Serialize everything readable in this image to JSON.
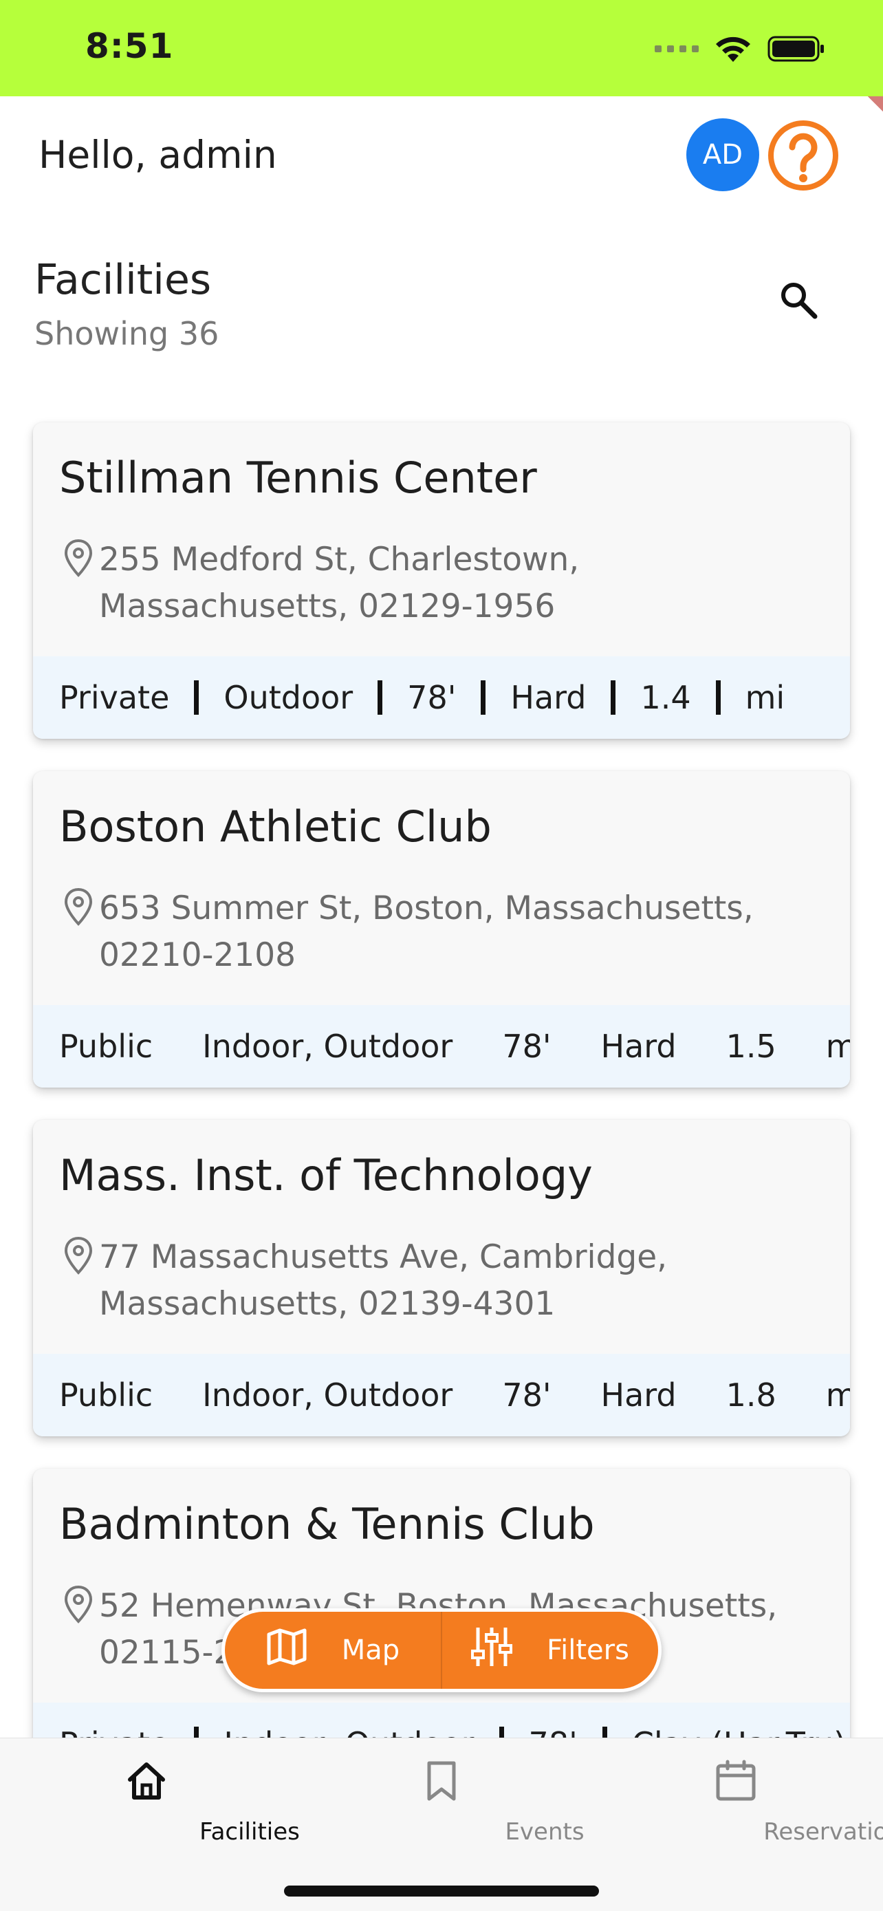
{
  "status_bar": {
    "time": "8:51"
  },
  "header": {
    "greeting": "Hello, admin",
    "avatar_initials": "AD"
  },
  "section": {
    "title": "Facilities",
    "count_text": "Showing 36"
  },
  "facilities": [
    {
      "name": "Stillman Tennis Center",
      "address": "255 Medford St, Charlestown, Massachusetts, 02129-1956",
      "tags": [
        "Private",
        "Outdoor",
        "78'",
        "Hard",
        "1.4",
        "mi"
      ]
    },
    {
      "name": "Boston Athletic Club",
      "address": "653 Summer St, Boston, Massachusetts, 02210-2108",
      "tags": [
        "Public",
        "Indoor, Outdoor",
        "78'",
        "Hard",
        "1.5",
        "mi"
      ]
    },
    {
      "name": "Mass. Inst. of Technology",
      "address": "77 Massachusetts Ave, Cambridge, Massachusetts, 02139-4301",
      "tags": [
        "Public",
        "Indoor, Outdoor",
        "78'",
        "Hard",
        "1.8",
        "mi"
      ]
    },
    {
      "name": "Badminton & Tennis Club",
      "address": "52 Hemenway St, Boston, Massachusetts, 02115-2",
      "tags": [
        "Private",
        "Indoor, Outdoor",
        "78'",
        "Clay (Har-Tru)",
        "",
        ""
      ]
    }
  ],
  "floating_actions": {
    "map_label": "Map",
    "filters_label": "Filters"
  },
  "bottom_nav": {
    "items": [
      {
        "label": "Facilities",
        "icon": "home-icon",
        "active": true
      },
      {
        "label": "Events",
        "icon": "bookmark-icon",
        "active": false
      },
      {
        "label": "Reservations",
        "icon": "calendar-icon",
        "active": false
      }
    ]
  },
  "colors": {
    "status_bar": "#b6ff3b",
    "accent_orange": "#f47c1f",
    "avatar_blue": "#1a7df0",
    "tag_band": "#eef6fd"
  }
}
